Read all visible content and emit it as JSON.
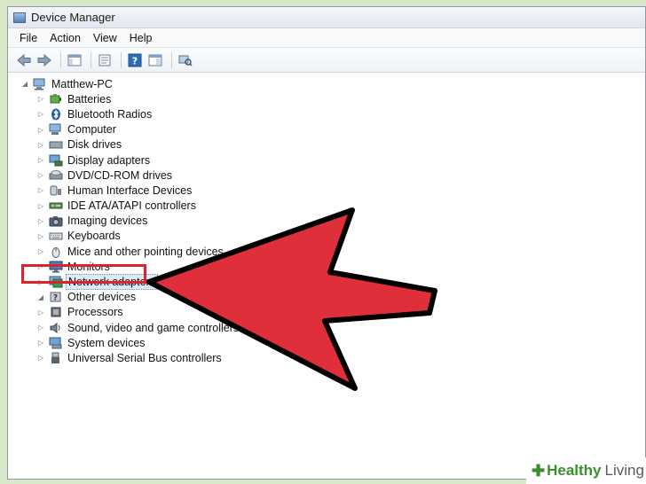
{
  "window": {
    "title": "Device Manager"
  },
  "menu": [
    "File",
    "Action",
    "View",
    "Help"
  ],
  "toolbar": {
    "icons": [
      "back-arrow-icon",
      "forward-arrow-icon",
      "show-hide-tree-icon",
      "properties-icon",
      "help-icon",
      "action-pane-icon",
      "scan-hardware-icon"
    ]
  },
  "tree": {
    "root": "Matthew-PC",
    "items": [
      {
        "label": "Batteries",
        "icon": "battery-icon"
      },
      {
        "label": "Bluetooth Radios",
        "icon": "bluetooth-icon"
      },
      {
        "label": "Computer",
        "icon": "computer-icon"
      },
      {
        "label": "Disk drives",
        "icon": "disk-drive-icon"
      },
      {
        "label": "Display adapters",
        "icon": "display-adapter-icon"
      },
      {
        "label": "DVD/CD-ROM drives",
        "icon": "dvd-drive-icon"
      },
      {
        "label": "Human Interface Devices",
        "icon": "hid-icon"
      },
      {
        "label": "IDE ATA/ATAPI controllers",
        "icon": "ide-controller-icon"
      },
      {
        "label": "Imaging devices",
        "icon": "camera-icon"
      },
      {
        "label": "Keyboards",
        "icon": "keyboard-icon"
      },
      {
        "label": "Mice and other pointing devices",
        "icon": "mouse-icon"
      },
      {
        "label": "Monitors",
        "icon": "monitor-icon"
      },
      {
        "label": "Network adapters",
        "icon": "network-adapter-icon"
      },
      {
        "label": "Other devices",
        "icon": "other-devices-icon"
      },
      {
        "label": "Processors",
        "icon": "processor-icon"
      },
      {
        "label": "Sound, video and game controllers",
        "icon": "speaker-icon"
      },
      {
        "label": "System devices",
        "icon": "system-devices-icon"
      },
      {
        "label": "Universal Serial Bus controllers",
        "icon": "usb-icon"
      }
    ]
  },
  "annotation": {
    "highlighted_item": "Network adapters",
    "color": "#d9232f"
  },
  "watermark": {
    "brand1": "Healthy",
    "brand2": "Living"
  }
}
